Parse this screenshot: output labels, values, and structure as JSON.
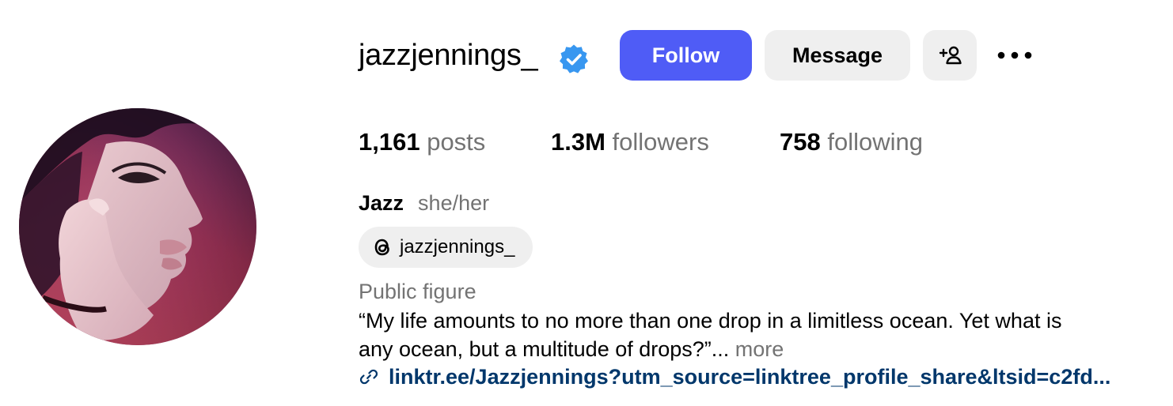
{
  "profile": {
    "username": "jazzjennings_",
    "verified": true,
    "name": "Jazz",
    "pronouns": "she/her",
    "category": "Public figure"
  },
  "actions": {
    "follow_label": "Follow",
    "message_label": "Message",
    "suggest_icon": "add-person-icon",
    "more_icon": "more-options-icon"
  },
  "stats": {
    "posts": {
      "count": "1,161",
      "label": "posts"
    },
    "followers": {
      "count": "1.3M",
      "label": "followers"
    },
    "following": {
      "count": "758",
      "label": "following"
    }
  },
  "threads": {
    "icon": "threads-icon",
    "handle": "jazzjennings_"
  },
  "bio": {
    "line1": "“My life amounts to no more than one drop in a limitless ocean. Yet what is",
    "line2": "any ocean, but a multitude of drops?”...",
    "more_label": "more"
  },
  "link": {
    "icon": "link-icon",
    "text": "linktr.ee/Jazzjennings?utm_source=linktree_profile_share&ltsid=c2fd..."
  },
  "colors": {
    "follow_button": "#4f5cf6",
    "secondary_button": "#efefef",
    "verified_badge": "#3897f0",
    "muted_text": "#737373",
    "link_text": "#00376b"
  }
}
